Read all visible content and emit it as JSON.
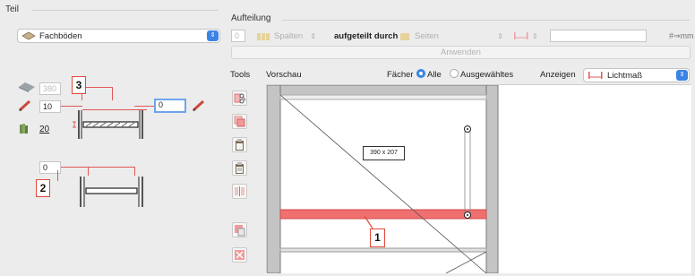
{
  "teil": {
    "title": "Teil",
    "selected": "Fachböden"
  },
  "aufteilung": {
    "title": "Aufteilung",
    "count_value": "0",
    "spalten_label": "Spalten",
    "divided_by_label": "aufgeteilt durch",
    "seiten_label": "Seiten",
    "unit_label": "#⇒mm",
    "apply_label": "Anwenden"
  },
  "params": {
    "dim_value": "380",
    "thickness_value": "10",
    "right_value": "0",
    "count_value": "20",
    "lower_value": "0"
  },
  "toolbar": {
    "tools_label": "Tools",
    "preview_label": "Vorschau",
    "faecher_label": "Fächer",
    "option_all": "Alle",
    "option_selected": "Ausgewähltes",
    "show_label": "Anzeigen",
    "show_value": "Lichtmaß"
  },
  "preview": {
    "size_label": "390 x 207"
  },
  "badges": {
    "b1": "1",
    "b2": "2",
    "b3": "3"
  },
  "colors": {
    "accent": "#3b84e4",
    "highlight": "#f07070",
    "annotation": "#e04a3a"
  }
}
